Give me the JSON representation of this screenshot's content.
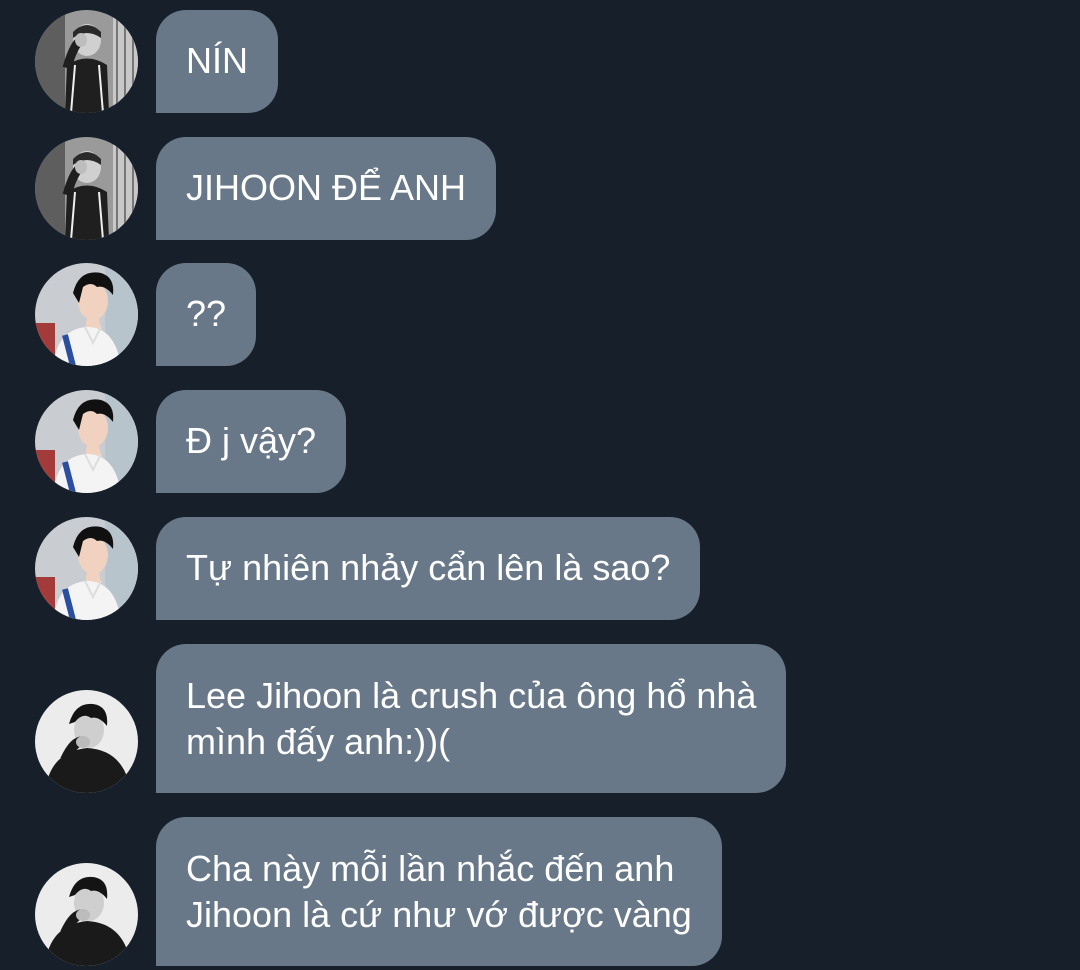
{
  "colors": {
    "background": "#17202a",
    "bubble": "#687888",
    "text": "#ffffff"
  },
  "messages": [
    {
      "avatar": "avatar-person-a-icon",
      "lines": [
        "NÍN"
      ]
    },
    {
      "avatar": "avatar-person-a-icon",
      "lines": [
        "JIHOON ĐỂ ANH"
      ]
    },
    {
      "avatar": "avatar-person-b-icon",
      "lines": [
        "??"
      ]
    },
    {
      "avatar": "avatar-person-b-icon",
      "lines": [
        "Đ j vậy?"
      ]
    },
    {
      "avatar": "avatar-person-b-icon",
      "lines": [
        "Tự nhiên nhảy cẩn lên là sao?"
      ]
    },
    {
      "avatar": "avatar-person-c-icon",
      "lines": [
        "Lee Jihoon là crush của ông hổ nhà",
        "mình đấy anh:))("
      ]
    },
    {
      "avatar": "avatar-person-c-icon",
      "lines": [
        "Cha này mỗi lần nhắc đến anh",
        "Jihoon là cứ như vớ được vàng"
      ]
    }
  ]
}
